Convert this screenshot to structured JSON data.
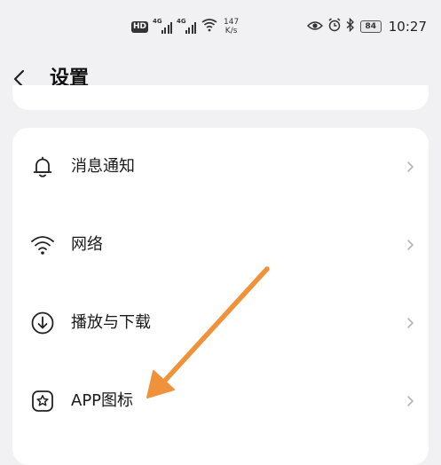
{
  "status_bar": {
    "hd_label": "HD",
    "sim1_tag": "4G",
    "sim2_tag": "4G",
    "net_speed_value": "147",
    "net_speed_unit": "K/s",
    "battery": "84",
    "time": "10:27"
  },
  "header": {
    "title": "设置"
  },
  "settings_items": [
    {
      "label": "消息通知",
      "icon": "bell-icon"
    },
    {
      "label": "网络",
      "icon": "wifi-icon"
    },
    {
      "label": "播放与下载",
      "icon": "download-icon"
    },
    {
      "label": "APP图标",
      "icon": "app-icon"
    }
  ],
  "colors": {
    "background": "#f1f1f3",
    "card": "#ffffff",
    "annotation_arrow": "#f0923a",
    "chevron": "#b5b5b5"
  }
}
